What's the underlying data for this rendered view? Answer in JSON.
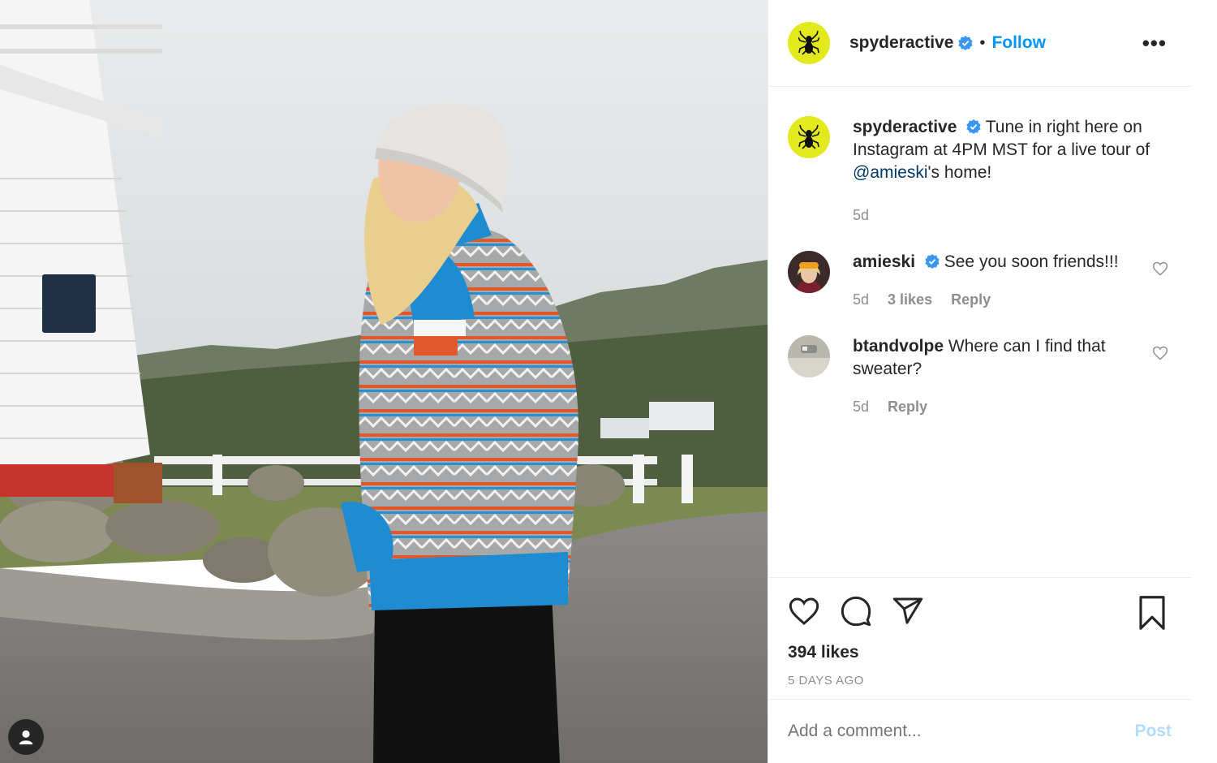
{
  "header": {
    "username": "spyderactive",
    "separator": "•",
    "follow_label": "Follow",
    "more_label": "•••"
  },
  "caption": {
    "username": "spyderactive",
    "text_before": "Tune in right here on Instagram at 4PM MST for a live tour of ",
    "mention": "@amieski",
    "text_after": "'s home!",
    "time": "5d"
  },
  "comments": [
    {
      "username": "amieski",
      "verified": true,
      "text": "See you soon friends!!!",
      "time": "5d",
      "likes": "3 likes",
      "reply_label": "Reply"
    },
    {
      "username": "btandvolpe",
      "verified": false,
      "text": "Where can I find that sweater?",
      "time": "5d",
      "reply_label": "Reply"
    }
  ],
  "footer": {
    "likes": "394 likes",
    "time_ago": "5 DAYS AGO",
    "comment_placeholder": "Add a comment...",
    "post_label": "Post"
  },
  "colors": {
    "accent_blue": "#0095f6",
    "avatar_yellow": "#e2ea1e",
    "mention": "#00376b",
    "muted": "#8e8e8e"
  },
  "icons": [
    "user-tag-icon",
    "spider-logo-icon",
    "verified-badge-icon",
    "heart-icon",
    "comment-icon",
    "share-icon",
    "bookmark-icon",
    "more-icon"
  ]
}
